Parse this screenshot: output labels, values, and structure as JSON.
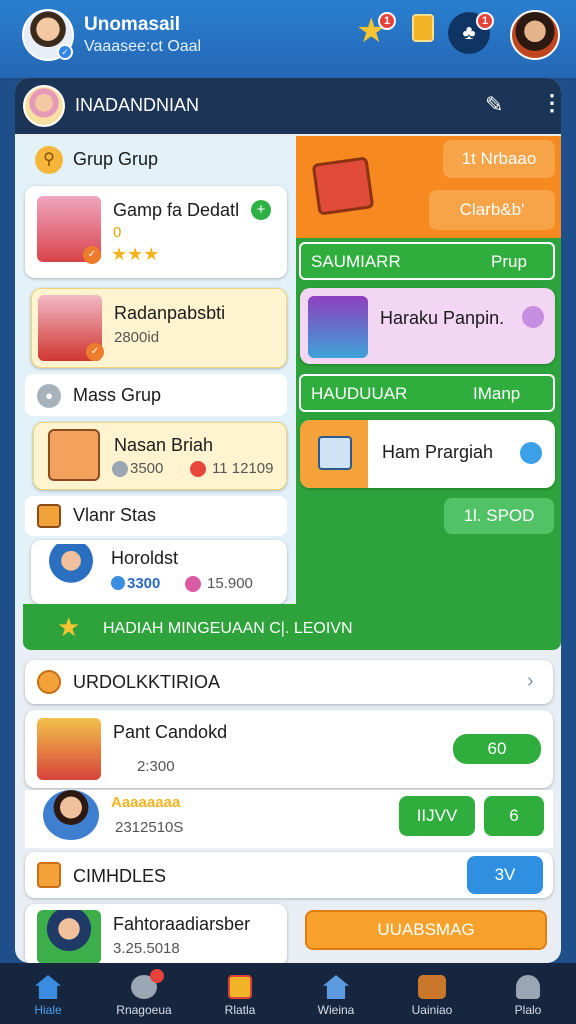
{
  "header": {
    "name": "Unomasail",
    "subtitle": "Vaaasee:ct Oaal",
    "badge_star": "1",
    "badge_gift": "1"
  },
  "panel": {
    "title": "INADANDNIAN"
  },
  "left": {
    "grup_title": "Grup Grup",
    "item1": {
      "title": "Gamp fa Dedatl",
      "sub": "0",
      "stars": "★★★"
    },
    "item2": {
      "title": "Radanpabsbti",
      "sub": "2800id"
    },
    "mass_title": "Mass Grup",
    "item3": {
      "title": "Nasan Briah",
      "v1": "3500",
      "v2": "11 12109"
    },
    "stats_title": "Vlanr Stas",
    "item4": {
      "title": "Horoldst",
      "v1": "3300",
      "v2": "15.900"
    }
  },
  "right": {
    "btn1": "1t Nrbaao",
    "btn2": "Clarb&b'",
    "green1": {
      "left": "SAUMIARR",
      "right": "Prup"
    },
    "card1": "Haraku Panpin.",
    "green2": {
      "left": "HAUDUUAR",
      "right": "IManp"
    },
    "card2": "Ham Prargiah",
    "btn3": "1l. SPOD"
  },
  "banner": "HADIAH MINGEUAAN C|. LEOIVN",
  "section": {
    "title": "URDOLKKTIRIOA"
  },
  "row1": {
    "title": "Pant Candokd",
    "v1": "2:300",
    "btn": "60"
  },
  "row2": {
    "title": "Aaaaaaaa",
    "sub": "2312510S",
    "btn1": "IIJVV",
    "btn2": "6"
  },
  "row3": {
    "title": "CIMHDLES",
    "btn": "3V"
  },
  "row4": {
    "title": "Fahtoraadiarsber",
    "sub": "3.25.5018",
    "btn": "UUABSMAG"
  },
  "nav": [
    "Hiale",
    "Rnagoeua",
    "Rlatla",
    "Wieina",
    "Uainiao",
    "Plalo"
  ]
}
